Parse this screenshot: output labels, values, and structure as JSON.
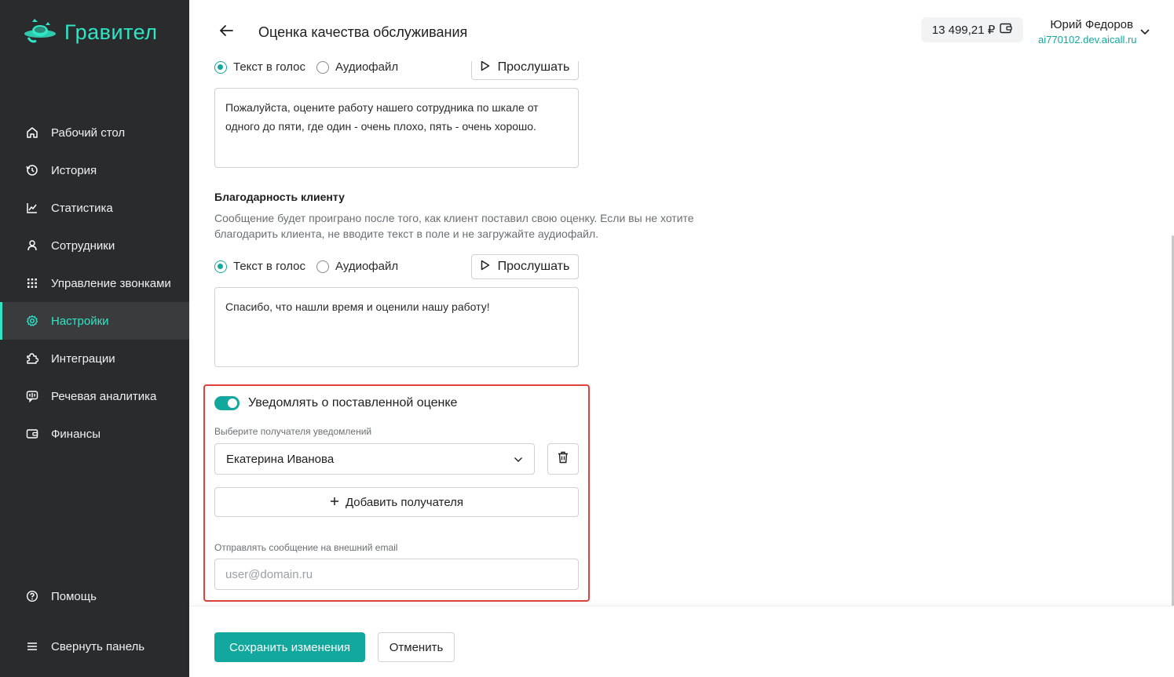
{
  "app": {
    "brand": "Гравител",
    "brand_color": "#2ee6c6",
    "accent_color": "#13a89e"
  },
  "sidebar": {
    "items": [
      {
        "label": "Рабочий стол",
        "icon": "home-icon"
      },
      {
        "label": "История",
        "icon": "history-icon"
      },
      {
        "label": "Статистика",
        "icon": "chart-icon"
      },
      {
        "label": "Сотрудники",
        "icon": "user-icon"
      },
      {
        "label": "Управление звонками",
        "icon": "dialpad-icon"
      },
      {
        "label": "Настройки",
        "icon": "gear-icon",
        "active": true
      },
      {
        "label": "Интеграции",
        "icon": "puzzle-icon"
      },
      {
        "label": "Речевая аналитика",
        "icon": "speech-icon"
      },
      {
        "label": "Финансы",
        "icon": "wallet-icon"
      }
    ],
    "help_label": "Помощь",
    "collapse_label": "Свернуть панель"
  },
  "header": {
    "title": "Оценка качества обслуживания",
    "balance": "13 499,21 ₽",
    "user_name": "Юрий Федоров",
    "user_domain": "ai770102.dev.aicall.ru"
  },
  "greeting_section": {
    "tts_label": "Текст в голос",
    "audio_label": "Аудиофайл",
    "play_label": "Прослушать",
    "text": "Пожалуйста, оцените работу нашего сотрудника по шкале от одного до пяти, где один - очень плохо, пять - очень хорошо."
  },
  "thanks_section": {
    "title": "Благодарность клиенту",
    "description": "Сообщение будет проиграно после того, как клиент поставил свою оценку. Если вы не хотите благодарить клиента, не вводите текст в поле и не загружайте аудиофайл.",
    "tts_label": "Текст в голос",
    "audio_label": "Аудиофайл",
    "play_label": "Прослушать",
    "text": "Спасибо, что нашли время и оценили нашу работу!"
  },
  "notify_section": {
    "toggle_label": "Уведомлять о поставленной оценке",
    "toggle_on": true,
    "recipient_label": "Выберите получателя уведомлений",
    "recipient_value": "Екатерина Иванова",
    "add_recipient_label": "Добавить получателя",
    "email_label": "Отправлять сообщение на внешний email",
    "email_placeholder": "user@domain.ru",
    "highlight_color": "#e0413d"
  },
  "footer": {
    "save_label": "Сохранить изменения",
    "cancel_label": "Отменить"
  }
}
